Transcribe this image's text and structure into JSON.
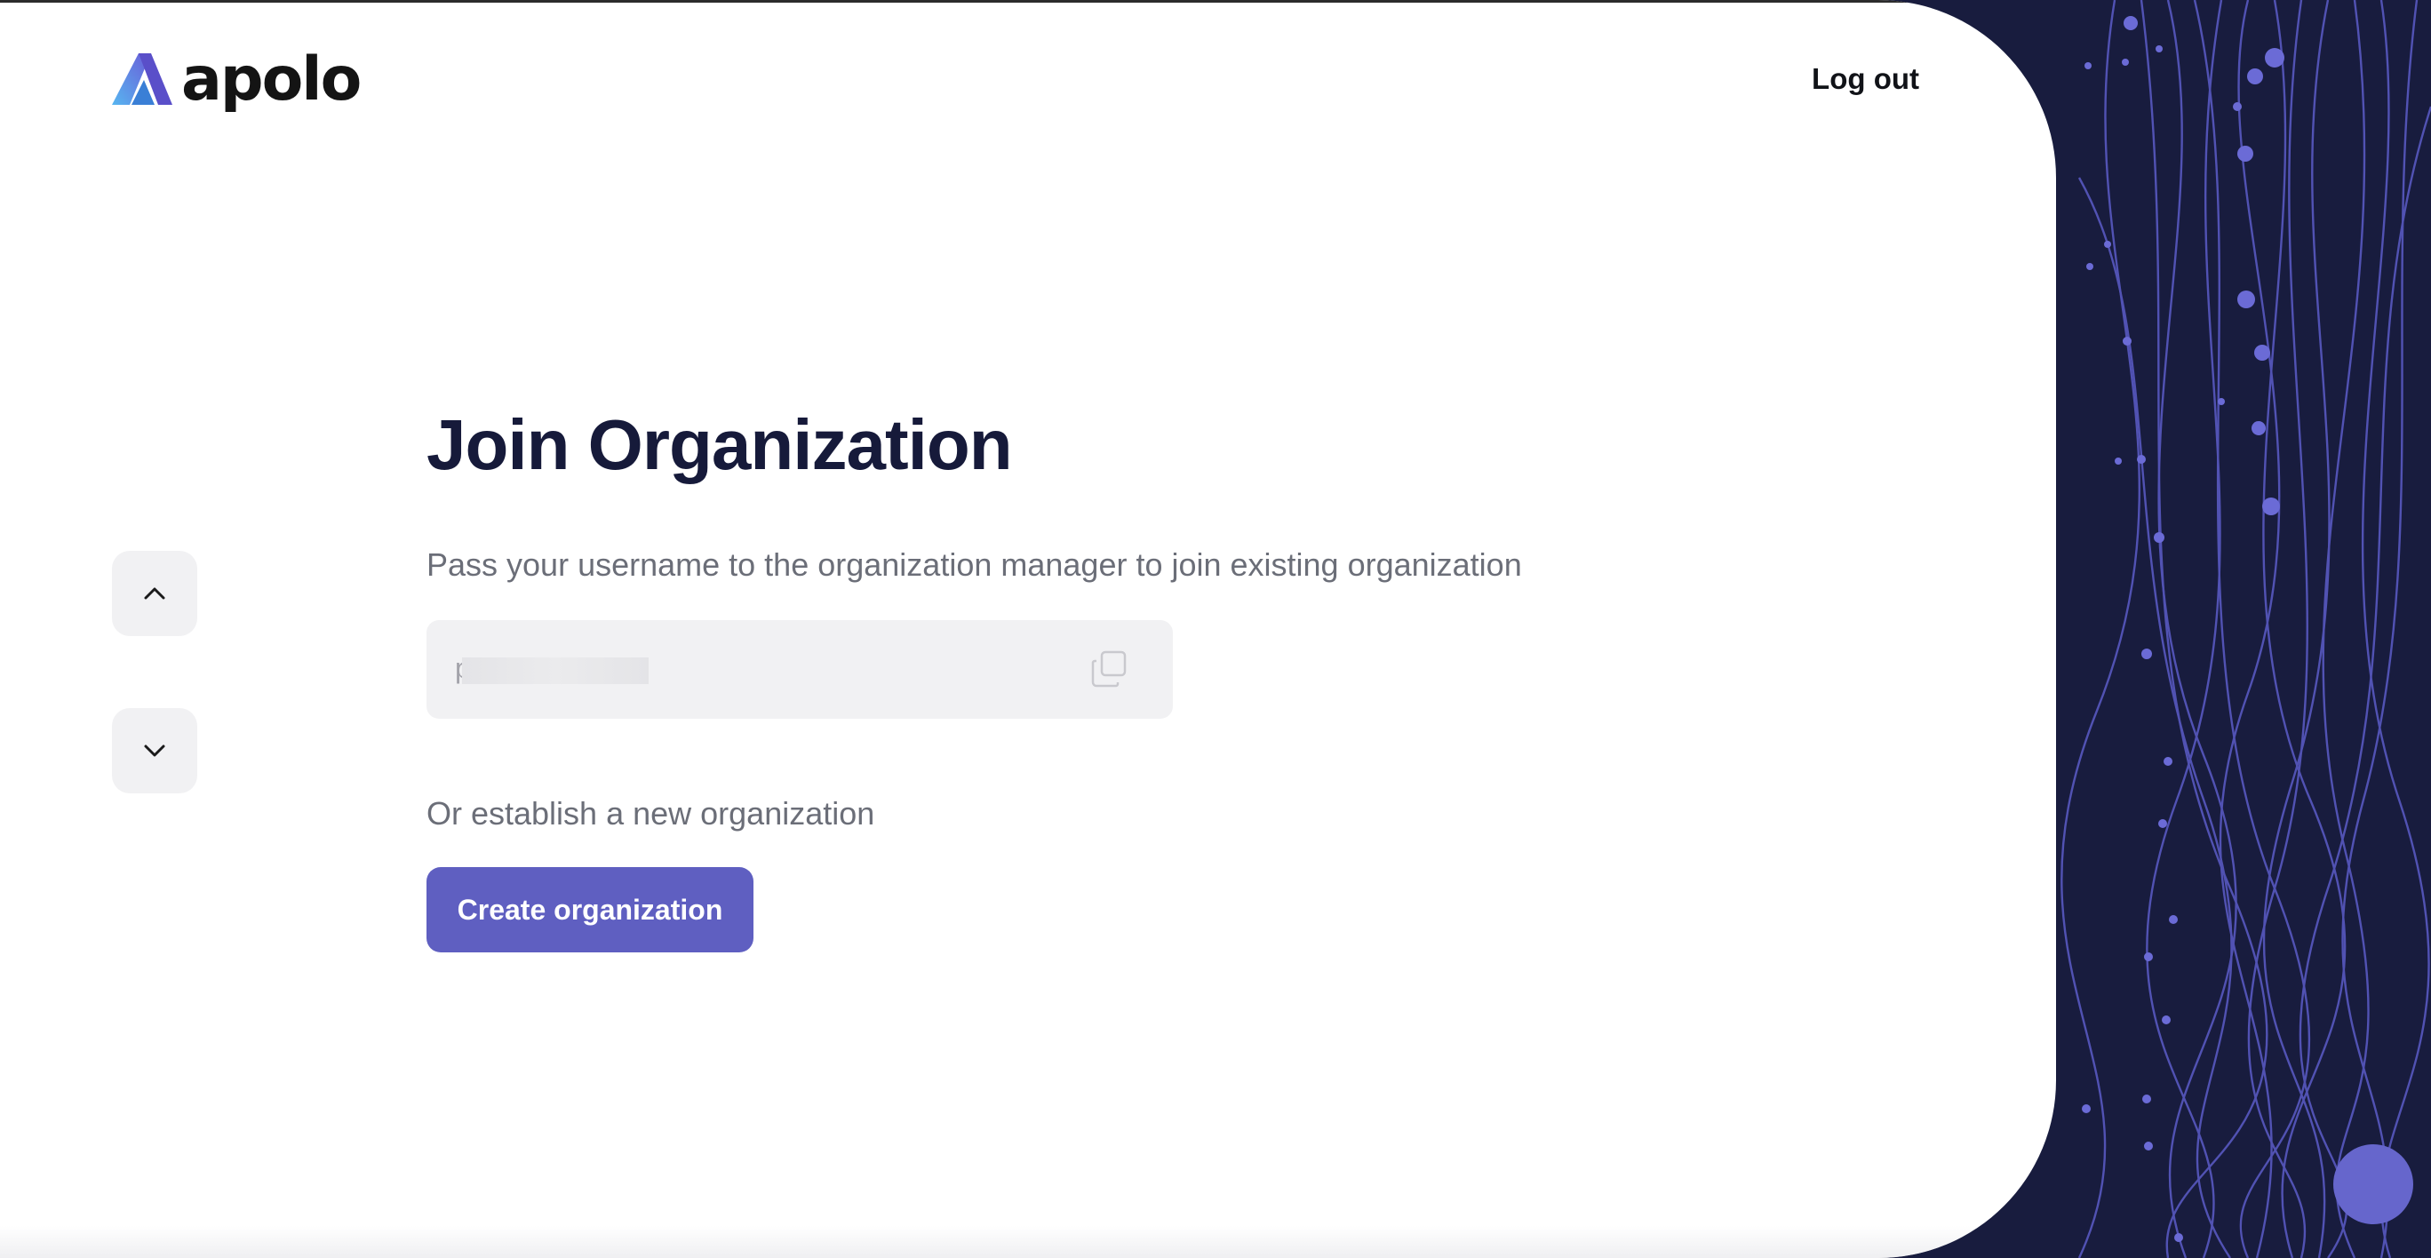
{
  "brand": {
    "name": "apolo"
  },
  "header": {
    "logout_label": "Log out"
  },
  "nav": {
    "up_icon": "chevron-up-icon",
    "down_icon": "chevron-down-icon"
  },
  "main": {
    "title": "Join Organization",
    "description": "Pass your username to the organization manager to join existing organization",
    "username_value": "p                  4",
    "copy_icon": "copy-icon",
    "alt_text": "Or establish a new organization",
    "create_button_label": "Create organization"
  },
  "colors": {
    "accent": "#5f5fc1",
    "title": "#161a3a",
    "muted_text": "#6b6e78",
    "background_dark": "#181c3e",
    "field_bg": "#f1f1f3"
  }
}
